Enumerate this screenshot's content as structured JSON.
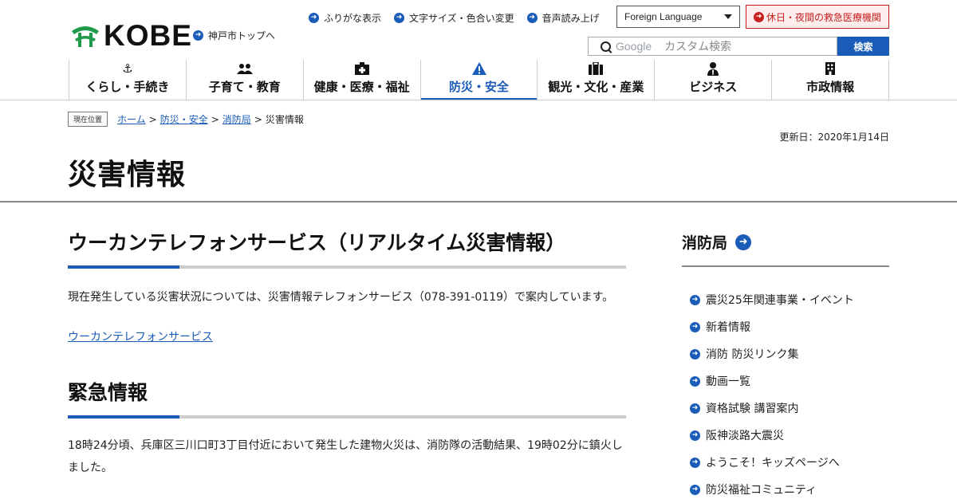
{
  "header": {
    "logo_text": "KOBE",
    "top_link": "神戸市トップへ",
    "util_nav": [
      "ふりがな表示",
      "文字サイズ・色合い変更",
      "音声読み上げ"
    ],
    "language_select": "Foreign Language",
    "emergency_link": "休日・夜間の救急医療機関",
    "search": {
      "placeholder": "カスタム検索",
      "brand": "Google",
      "button": "検索"
    }
  },
  "global_nav": [
    {
      "label": "くらし・手続き",
      "icon": "anchor-icon"
    },
    {
      "label": "子育て・教育",
      "icon": "people-icon"
    },
    {
      "label": "健康・医療・福祉",
      "icon": "hospital-icon"
    },
    {
      "label": "防災・安全",
      "icon": "warning-icon",
      "active": true
    },
    {
      "label": "観光・文化・産業",
      "icon": "suitcase-icon"
    },
    {
      "label": "ビジネス",
      "icon": "person-icon"
    },
    {
      "label": "市政情報",
      "icon": "building-icon"
    }
  ],
  "breadcrumb": {
    "label": "現在位置",
    "items": [
      "ホーム",
      "防災・安全",
      "消防局"
    ],
    "current": "災害情報",
    "separator": ">"
  },
  "updated": "更新日：2020年1月14日",
  "page_title": "災害情報",
  "main": {
    "section1": {
      "heading": "ウーカンテレフォンサービス（リアルタイム災害情報）",
      "text": "現在発生している災害状況については、災害情報テレフォンサービス（078-391-0119）で案内しています。",
      "link": "ウーカンテレフォンサービス"
    },
    "section2": {
      "heading": "緊急情報",
      "text": "18時24分頃、兵庫区三川口町3丁目付近において発生した建物火災は、消防隊の活動結果、19時02分に鎮火しました。"
    }
  },
  "sidebar": {
    "heading": "消防局",
    "items": [
      "震災25年関連事業・イベント",
      "新着情報",
      "消防 防災リンク集",
      "動画一覧",
      "資格試験 講習案内",
      "阪神淡路大震災",
      "ようこそ！キッズページへ",
      "防災福祉コミュニティ"
    ]
  },
  "colors": {
    "accent": "#1a5cb8",
    "emergency": "#c8201f",
    "logo_green": "#1f9a4b"
  }
}
